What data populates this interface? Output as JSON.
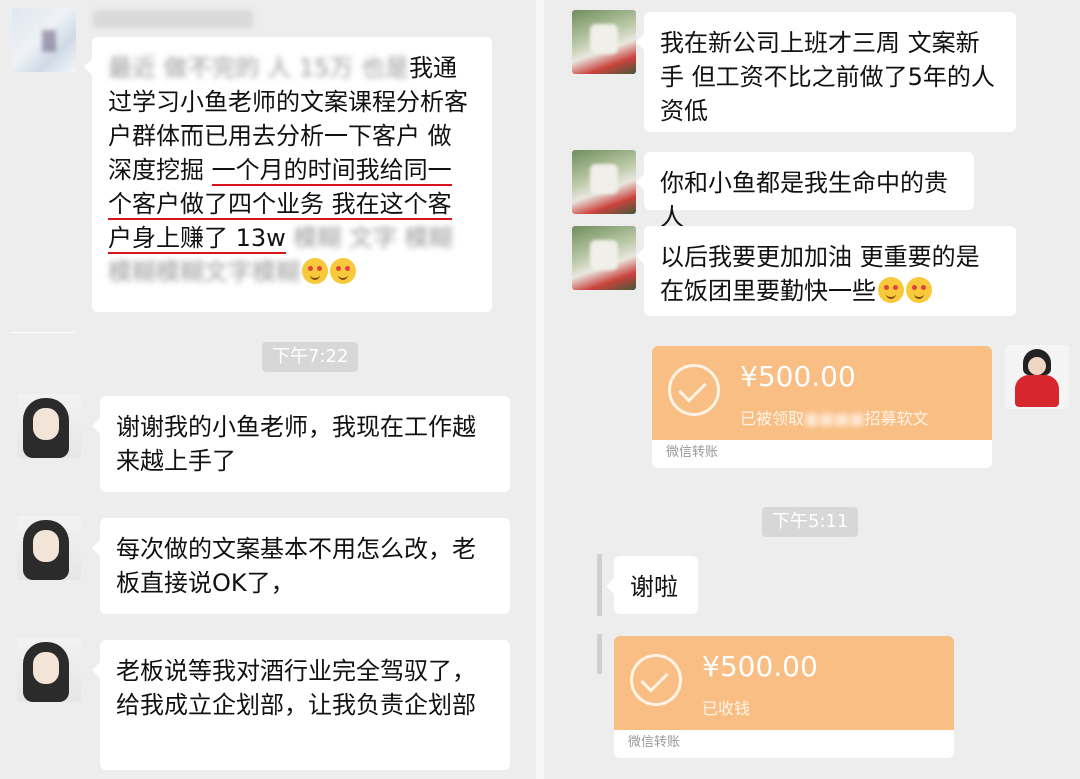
{
  "left_panel": {
    "top_message": {
      "hidden_prefix": "最近 做不完的 人 15万 也是",
      "lines": [
        "我通",
        "过学习小鱼老师的文案课程分析客",
        "户群体而已用去分析一下客户 做",
        "深度挖掘 ",
        "一个月的时间我给同一",
        "个客户做了四个业务 我在这个客",
        "户身上赚了 13w",
        " 模糊 文字 模糊",
        "模糊模糊文字模糊"
      ]
    },
    "timestamp": "下午7:22",
    "messages": [
      {
        "text": "谢谢我的小鱼老师，我现在工作越来越上手了"
      },
      {
        "text": "每次做的文案基本不用怎么改，老板直接说OK了，"
      },
      {
        "text": "老板说等我对酒行业完全驾驭了，给我成立企划部，让我负责企划部"
      }
    ]
  },
  "right_panel": {
    "messages": [
      {
        "text": "我在新公司上班才三周  文案新手  但工资不比之前做了5年的人资低"
      },
      {
        "text": "你和小鱼都是我生命中的贵人"
      },
      {
        "text": "以后我要更加加油  更重要的是在饭团里要勤快一些"
      }
    ],
    "transfer_1": {
      "amount": "¥500.00",
      "status": "已被领取",
      "status_suffix": "招募软文",
      "footer": "微信转账"
    },
    "timestamp": "下午5:11",
    "thanks_message": {
      "text": "谢啦"
    },
    "transfer_2": {
      "amount": "¥500.00",
      "status": "已收钱",
      "footer": "微信转账"
    }
  }
}
